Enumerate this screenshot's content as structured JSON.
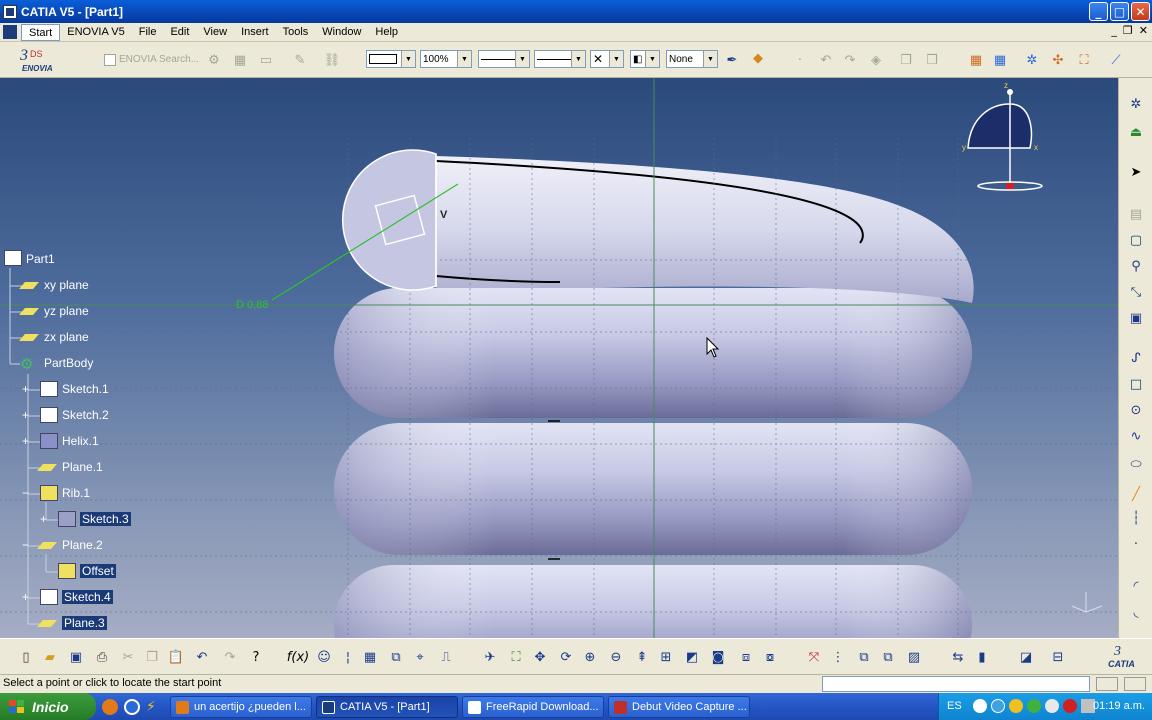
{
  "window": {
    "title": "CATIA V5 - [Part1]",
    "controls": {
      "minimize": "_",
      "maximize": "□",
      "close": "✕"
    }
  },
  "menubar": {
    "items": [
      "Start",
      "ENOVIA V5",
      "File",
      "Edit",
      "View",
      "Insert",
      "Tools",
      "Window",
      "Help"
    ],
    "doc_controls": {
      "minimize": "_",
      "restore": "❐",
      "close": "✕"
    }
  },
  "toolbar_top": {
    "enovia_logo": "ENOVIA",
    "search_label": "ENOVIA Search...",
    "zoom_value": "100%",
    "layer_value": "None"
  },
  "viewport": {
    "dimension_label": "D 0,88",
    "sketch_axis_label": "V",
    "compass": {
      "z": "z",
      "y": "y",
      "x": "x"
    },
    "tree": {
      "items": [
        {
          "label": "Part1",
          "selected": false
        },
        {
          "label": "xy plane",
          "selected": false
        },
        {
          "label": "yz plane",
          "selected": false
        },
        {
          "label": "zx plane",
          "selected": false
        },
        {
          "label": "PartBody",
          "selected": false
        },
        {
          "label": "Sketch.1",
          "selected": false
        },
        {
          "label": "Sketch.2",
          "selected": false
        },
        {
          "label": "Helix.1",
          "selected": false
        },
        {
          "label": "Plane.1",
          "selected": false
        },
        {
          "label": "Rib.1",
          "selected": false
        },
        {
          "label": "Sketch.3",
          "selected": true
        },
        {
          "label": "Plane.2",
          "selected": false
        },
        {
          "label": "Offset",
          "selected": true
        },
        {
          "label": "Sketch.4",
          "selected": true
        },
        {
          "label": "Plane.3",
          "selected": true
        }
      ]
    }
  },
  "statusbar": {
    "text": "Select a point or click to locate the start point"
  },
  "taskbar": {
    "start_label": "Inicio",
    "tasks": [
      {
        "label": "un acertijo ¿pueden l...",
        "active": false,
        "color": "#e07a1a"
      },
      {
        "label": "CATIA V5 - [Part1]",
        "active": true,
        "color": "#1b3c7a"
      },
      {
        "label": "FreeRapid Download...",
        "active": false,
        "color": "#3a6fd8"
      },
      {
        "label": "Debut Video Capture ...",
        "active": false,
        "color": "#c0302a"
      }
    ],
    "language": "ES",
    "clock": "01:19 a.m."
  },
  "colors": {
    "titlebar": "#0a5fd8",
    "chrome": "#ece9d8",
    "viewport_top": "#2b4a7c",
    "viewport_bottom": "#a6adc4",
    "spring": "#b8bcdc",
    "taskbar": "#2456c4",
    "start_button": "#2f8a2f",
    "tray": "#1a9ee6"
  }
}
